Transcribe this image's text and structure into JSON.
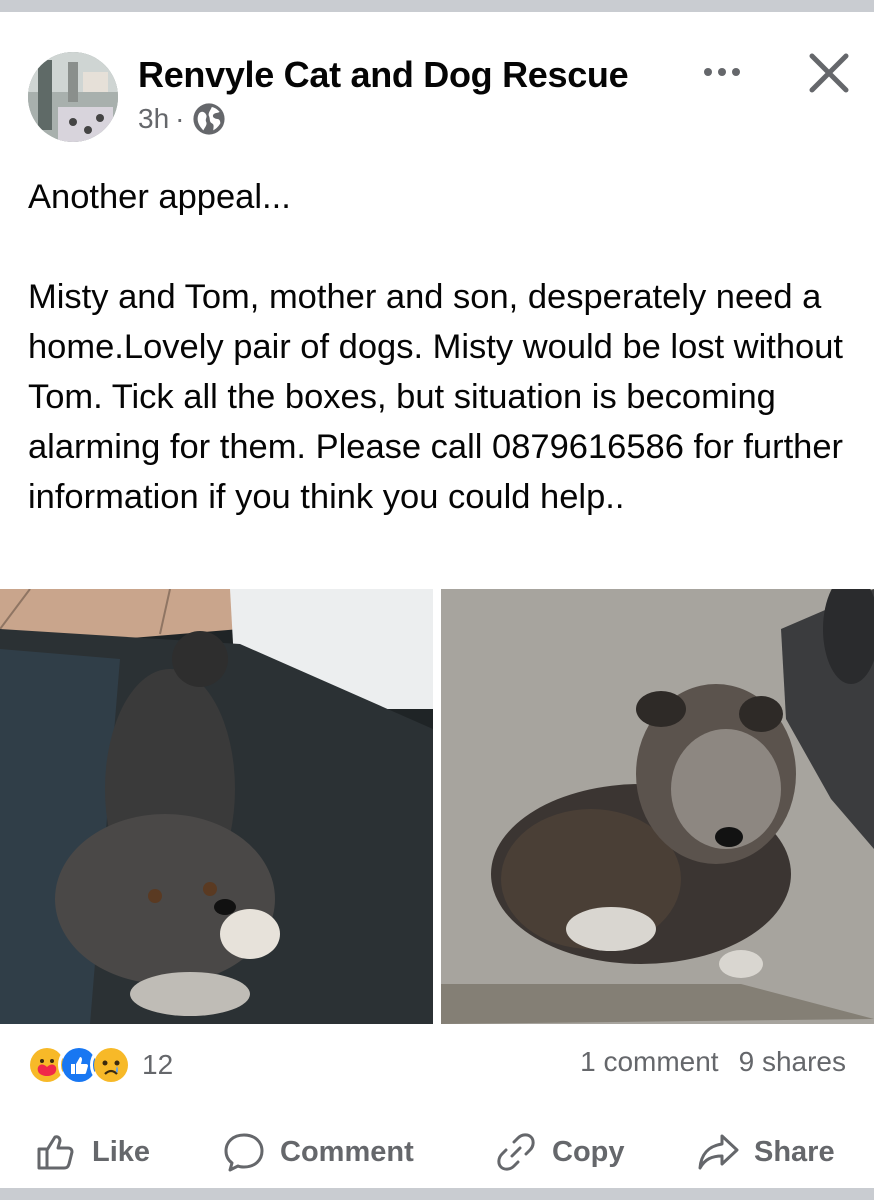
{
  "post": {
    "page_name": "Renvyle Cat and Dog Rescue",
    "time": "3h",
    "separator": "·",
    "audience_icon": "globe-icon",
    "text": "Another appeal...\n\nMisty and Tom, mother and son, desperately need a home.Lovely pair of dogs. Misty would be lost without Tom. Tick all the boxes, but situation is becoming alarming for them. Please call 0879616586 for further information if you think you could help..",
    "photos": [
      "dog-photo-misty",
      "dog-photo-tom"
    ]
  },
  "engagement": {
    "reaction_icons": [
      "care-reaction-icon",
      "like-reaction-icon",
      "sad-reaction-icon"
    ],
    "reaction_count": "12",
    "comments": "1 comment",
    "shares": "9 shares"
  },
  "actions": {
    "like": "Like",
    "comment": "Comment",
    "copy": "Copy",
    "share": "Share"
  },
  "colors": {
    "text": "#050505",
    "secondary": "#65676b",
    "like_blue": "#1877f2"
  }
}
